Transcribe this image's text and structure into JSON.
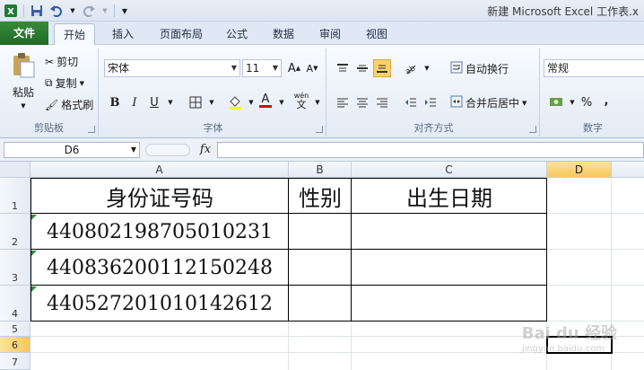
{
  "title": "新建 Microsoft Excel 工作表.x",
  "tabs": [
    "文件",
    "开始",
    "插入",
    "页面布局",
    "公式",
    "数据",
    "审阅",
    "视图"
  ],
  "clipboard": {
    "paste": "粘贴",
    "cut": "剪切",
    "copy": "复制",
    "format_painter": "格式刷",
    "label": "剪贴板"
  },
  "font": {
    "name": "宋体",
    "size": "11",
    "label": "字体",
    "bold": "B",
    "italic": "I",
    "underline": "U"
  },
  "alignment": {
    "wrap": "自动换行",
    "merge": "合并后居中",
    "label": "对齐方式"
  },
  "number": {
    "format": "常规",
    "label": "数字",
    "percent": "%",
    "comma": ","
  },
  "formula_bar": {
    "name_box": "D6",
    "fx": "fx",
    "value": ""
  },
  "columns": [
    "A",
    "B",
    "C",
    "D"
  ],
  "rows": [
    "1",
    "2",
    "3",
    "4",
    "5",
    "6",
    "7"
  ],
  "table": {
    "headers": [
      "身份证号码",
      "性别",
      "出生日期"
    ],
    "ids": [
      "440802198705010231",
      "440836200112150248",
      "440527201010142612"
    ]
  },
  "watermark": {
    "main": "Bai du 经验",
    "sub": "jingyan.baidu.com"
  }
}
